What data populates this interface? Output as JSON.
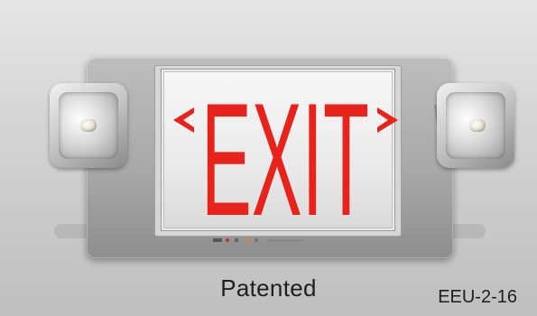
{
  "sign": {
    "legend": "EXIT",
    "legend_color": "#e8231b",
    "chevrons": [
      "left",
      "right"
    ]
  },
  "caption": "Patented",
  "model_number": "EEU-2-16"
}
